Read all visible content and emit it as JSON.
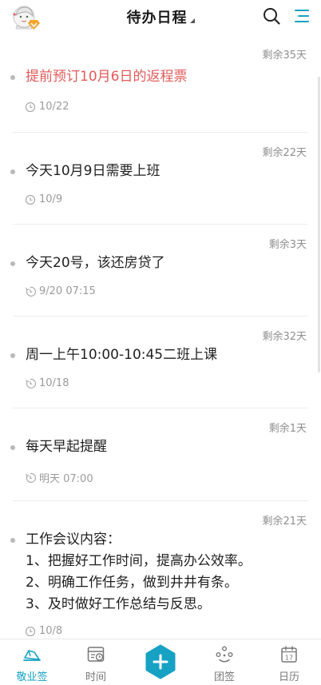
{
  "header": {
    "title": "待办日程",
    "avatar_icon": "avatar-girl-with-badge",
    "search_icon": "search-icon",
    "menu_icon": "list-menu-icon",
    "accent": "#17a2c4"
  },
  "items": [
    {
      "remaining": "剩余35天",
      "lines": [
        "提前预订10月6日的返程票"
      ],
      "highlight": true,
      "meta_icon": "clock-icon",
      "meta": "10/22"
    },
    {
      "remaining": "剩余22天",
      "lines": [
        "今天10月9日需要上班"
      ],
      "highlight": false,
      "meta_icon": "clock-icon",
      "meta": "10/9"
    },
    {
      "remaining": "剩余3天",
      "lines": [
        "今天20号，该还房贷了"
      ],
      "highlight": false,
      "meta_icon": "repeat-clock-icon",
      "meta": "9/20 07:15"
    },
    {
      "remaining": "剩余32天",
      "lines": [
        "周一上午10:00-10:45二班上课"
      ],
      "highlight": false,
      "meta_icon": "repeat-clock-icon",
      "meta": "10/18"
    },
    {
      "remaining": "剩余1天",
      "lines": [
        "每天早起提醒"
      ],
      "highlight": false,
      "meta_icon": "repeat-clock-icon",
      "meta": "明天 07:00"
    },
    {
      "remaining": "剩余21天",
      "lines": [
        "工作会议内容：",
        "1、把握好工作时间，提高办公效率。",
        "2、明确工作任务，做到井井有条。",
        "3、及时做好工作总结与反思。"
      ],
      "highlight": false,
      "meta_icon": "clock-icon",
      "meta": "10/8"
    }
  ],
  "tabs": [
    {
      "label": "敬业签",
      "icon": "notes-icon",
      "active": true
    },
    {
      "label": "时间",
      "icon": "time-board-icon",
      "active": false
    },
    {
      "label": "",
      "icon": "add-hexagon-icon",
      "active": false
    },
    {
      "label": "团签",
      "icon": "team-icon",
      "active": false
    },
    {
      "label": "日历",
      "icon": "calendar-icon",
      "active": false
    }
  ],
  "calendar_day": "17",
  "colors": {
    "highlight_text": "#e35a5a",
    "accent": "#17a2c4",
    "meta": "#9b9b9b"
  }
}
